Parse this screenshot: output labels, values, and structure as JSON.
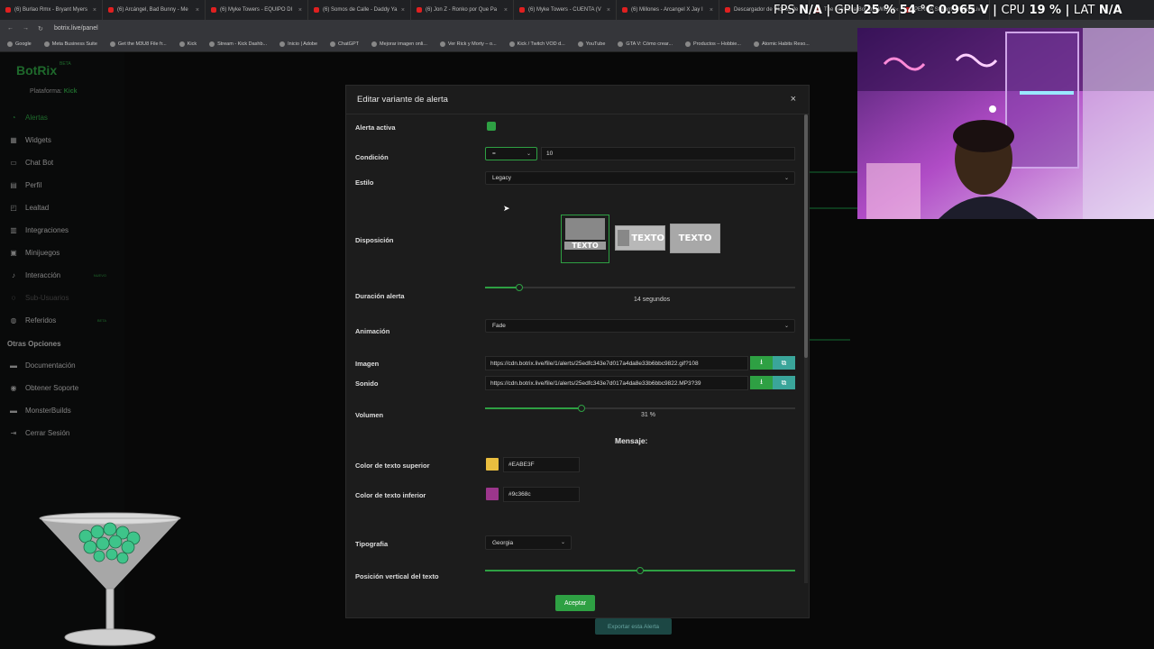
{
  "browser": {
    "tabs": [
      "(6) Burlao Rmx - Bryant Myers",
      "(6) Arcángel, Bad Bunny - Me",
      "(6) Myke Towers - EQUIPO DI",
      "(6) Somos de Calle - Daddy Ya",
      "(6) Jon Z - Ronko por Que Pa",
      "(6) Myke Towers - CUENTA (V",
      "(6) Millones - Arcangel X Jay I",
      "Descargador de Vídeos de Y",
      "The best ChatBot and Widget",
      "PERMA Stream - Watch Liv"
    ],
    "url": "botrix.live/panel",
    "bookmarks": [
      "Google",
      "Meta Business Suite",
      "Get the M3U8 File fr...",
      "Kick",
      "Stream - Kick Dashb...",
      "Inicio | Adobe",
      "ChatGPT",
      "Mejorar imagen onli...",
      "Ver Rick y Morty – o...",
      "Kick / Twitch VOD d...",
      "YouTube",
      "GTA V: Cómo crear...",
      "Productos – Hobbie...",
      "Atomic Habits Reso..."
    ]
  },
  "osd": {
    "fps_label": "FPS",
    "fps_value": "N/A",
    "gpu_label": "GPU",
    "gpu_value": "25 % 54 °C 0.965 V",
    "cpu_label": "CPU",
    "cpu_value": "19 %",
    "lat_label": "LAT",
    "lat_value": "N/A"
  },
  "sidebar": {
    "brand": "BotRix",
    "beta": "BETA",
    "platform_label": "Plataforma:",
    "platform_value": "Kick",
    "items": [
      {
        "label": "Alertas",
        "icon": "bell-icon",
        "glyph": "◔"
      },
      {
        "label": "Widgets",
        "icon": "widgets-icon",
        "glyph": "▦"
      },
      {
        "label": "Chat Bot",
        "icon": "chat-icon",
        "glyph": "▭"
      },
      {
        "label": "Perfil",
        "icon": "profile-icon",
        "glyph": "▤"
      },
      {
        "label": "Lealtad",
        "icon": "loyalty-icon",
        "glyph": "◰"
      },
      {
        "label": "Integraciones",
        "icon": "integrations-icon",
        "glyph": "▥"
      },
      {
        "label": "Minijuegos",
        "icon": "games-icon",
        "glyph": "▣"
      },
      {
        "label": "Interacción",
        "icon": "music-icon",
        "glyph": "♪",
        "tag": "NUEVO"
      },
      {
        "label": "Sub-Usuarios",
        "icon": "subusers-icon",
        "glyph": "◌"
      },
      {
        "label": "Referidos",
        "icon": "referrals-icon",
        "glyph": "◍",
        "tag": "BETA"
      }
    ],
    "section_title": "Otras Opciones",
    "other_items": [
      {
        "label": "Documentación",
        "icon": "docs-icon",
        "glyph": "▬"
      },
      {
        "label": "Obtener Soporte",
        "icon": "support-icon",
        "glyph": "◉"
      },
      {
        "label": "MonsterBuilds",
        "icon": "monsterbuilds-icon",
        "glyph": "▬"
      },
      {
        "label": "Cerrar Sesión",
        "icon": "logout-icon",
        "glyph": "⇥"
      }
    ]
  },
  "modal": {
    "title": "Editar variante de alerta",
    "close": "×",
    "active_label": "Alerta activa",
    "condition_label": "Condición",
    "condition_operator": "=",
    "condition_value": "10",
    "style_label": "Estilo",
    "style_value": "Legacy",
    "layout_label": "Disposición",
    "layout_text": "TEXTO",
    "duration_label": "Duración alerta",
    "duration_value": "14",
    "duration_unit": "segundos",
    "duration_fraction": 0.11,
    "animation_label": "Animación",
    "animation_value": "Fade",
    "image_label": "Imagen",
    "image_url": "https://cdn.botrix.live/file/1/alerts/25edfc343e7d017a4da8e33b6bbc9822.gif?108",
    "sound_label": "Sonido",
    "sound_url": "https://cdn.botrix.live/file/1/alerts/25edfc343e7d017a4da8e33b6bbc9822.MP3?39",
    "volume_label": "Volumen",
    "volume_value": "31",
    "volume_unit": "%",
    "volume_fraction": 0.31,
    "message_heading": "Mensaje:",
    "top_color_label": "Color de texto superior",
    "top_color_value": "#EABE3F",
    "bottom_color_label": "Color de texto inferior",
    "bottom_color_value": "#9c368c",
    "font_label": "Tipografia",
    "font_value": "Georgia",
    "vertical_pos_label": "Posición vertical del texto",
    "vertical_pos_fraction": 0.5,
    "accept_label": "Aceptar"
  },
  "background": {
    "export_label": "Exportar esta Alerta"
  },
  "colors": {
    "accent": "#2ea043",
    "teal": "#3aa59a",
    "top_swatch": "#EABE3F",
    "bottom_swatch": "#9c368c"
  }
}
